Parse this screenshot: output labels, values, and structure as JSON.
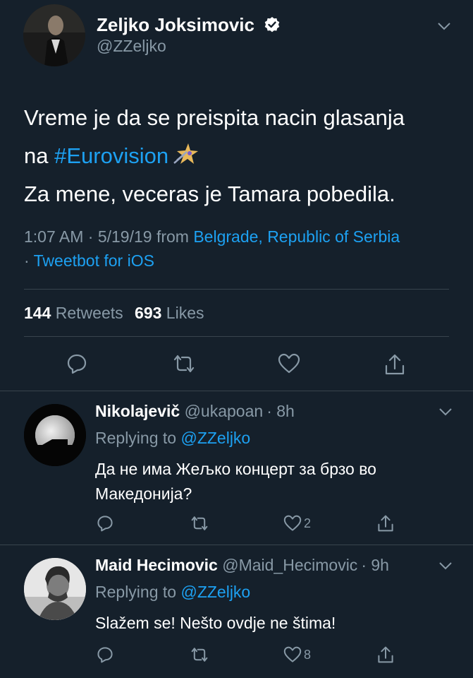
{
  "colors": {
    "background": "#15202b",
    "accent": "#1da1f2",
    "muted": "#8899a6",
    "divider": "#38444d"
  },
  "tweet": {
    "author_name": "Zeljko Joksimovic",
    "author_handle": "@ZZeljko",
    "text_line1": "Vreme je da se preispita nacin glasanja",
    "text_line2_prefix": "na ",
    "hashtag": "#Eurovision",
    "text_line3": "Za mene, veceras je Tamara pobedila.",
    "time": "1:07 AM · 5/19/19 from ",
    "location": "Belgrade, Republic of Serbia",
    "client_prefix": "· ",
    "client": "Tweetbot for iOS",
    "retweets_count": "144",
    "retweets_label": "Retweets",
    "likes_count": "693",
    "likes_label": "Likes"
  },
  "replies": [
    {
      "name": "Nikolajevič",
      "handle": "@ukapoan",
      "time": "· 8h",
      "replying_label": "Replying to",
      "replying_handle": "@ZZeljko",
      "text_line1": "Да не има Жељко концерт за брзо во",
      "text_line2": "Македонија?",
      "like_count": "2"
    },
    {
      "name": "Maid Hecimovic",
      "handle": "@Maid_Hecimovic",
      "time": "· 9h",
      "replying_label": "Replying to",
      "replying_handle": "@ZZeljko",
      "text_line1": "Slažem se! Nešto ovdje ne štima!",
      "like_count": "8"
    }
  ]
}
